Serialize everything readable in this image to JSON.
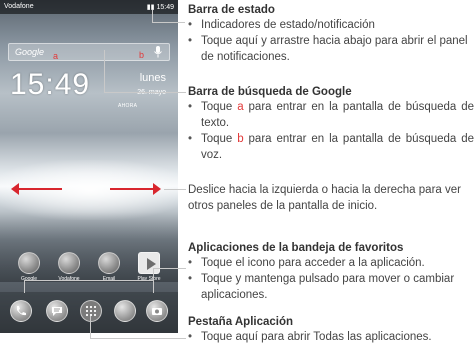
{
  "phone": {
    "carrier": "Vodafone",
    "status_time": "15:49",
    "search_placeholder": "Google",
    "marker_a": "a",
    "marker_b": "b",
    "clock": "15:49",
    "day": "lunes",
    "date": "26. mayo",
    "alarm_label": "AHORA",
    "apps": [
      "Google",
      "Vodafone",
      "Email",
      "Play Store"
    ]
  },
  "sections": {
    "status_bar": {
      "title": "Barra de estado",
      "bullets": [
        "Indicadores de estado/notificación",
        "Toque aquí y arrastre hacia abajo para abrir el panel de notificaciones."
      ]
    },
    "google_bar": {
      "title": "Barra de búsqueda de Google",
      "bullet1_pre": "Toque ",
      "bullet1_letter": "a",
      "bullet1_post": " para entrar en la pantalla de búsqueda de texto.",
      "bullet2_pre": "Toque ",
      "bullet2_letter": "b",
      "bullet2_post": " para entrar en la pantalla de búsqueda de voz."
    },
    "swipe": {
      "text": "Deslice hacia la izquierda o hacia la derecha para ver otros paneles de la pantalla de inicio."
    },
    "favorites": {
      "title": "Aplicaciones de la bandeja de favoritos",
      "bullets": [
        "Toque el icono para acceder a la aplicación.",
        "Toque y mantenga pulsado para mover o cambiar aplicaciones."
      ]
    },
    "app_tab": {
      "title": "Pestaña Aplicación",
      "bullets": [
        "Toque aquí para abrir Todas las aplicaciones."
      ]
    }
  },
  "colors": {
    "accent_red": "#e23a3a",
    "arrow_red": "#d8262e"
  }
}
